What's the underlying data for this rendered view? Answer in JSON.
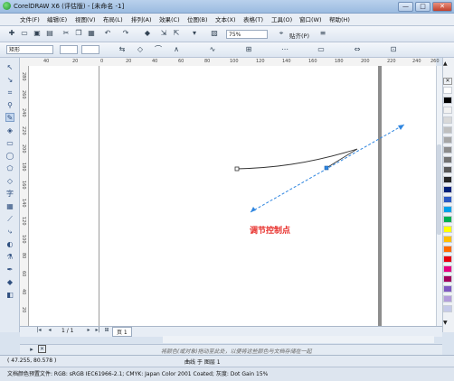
{
  "window": {
    "title": "CorelDRAW X6 (评估版) - [未命名 -1]",
    "controls": [
      "—",
      "□",
      "✕"
    ]
  },
  "menu": [
    "文件(F)",
    "编辑(E)",
    "视图(V)",
    "布局(L)",
    "排列(A)",
    "效果(C)",
    "位图(B)",
    "文本(X)",
    "表格(T)",
    "工具(O)",
    "窗口(W)",
    "帮助(H)"
  ],
  "toolbar": {
    "zoom_value": "75%",
    "snap_label": "贴齐(P)"
  },
  "property_bar": {
    "shape_type": "矩形",
    "field1": "",
    "field2": ""
  },
  "ruler": {
    "h_ticks": [
      "40",
      "20",
      "0",
      "20",
      "40",
      "60",
      "80",
      "100",
      "120",
      "140",
      "160",
      "180",
      "200",
      "220",
      "240",
      "260"
    ],
    "v_ticks": [
      "280",
      "260",
      "240",
      "220",
      "200",
      "180",
      "160",
      "140",
      "120",
      "100",
      "80",
      "60",
      "40",
      "20"
    ]
  },
  "annotation": "调节控制点",
  "page_nav": {
    "counter": "1 / 1",
    "tab": "页 1"
  },
  "hint": "将颜色(或对象)拖动至此处，以便将这些颜色与文档存储在一起",
  "status": {
    "coords": "( 47.255, 80.578 )",
    "object_info": "曲线 于 图层 1"
  },
  "doc_profile": "文档颜色预置文件: RGB: sRGB IEC61966-2.1; CMYK: Japan Color 2001 Coated; 灰度: Dot Gain 15%",
  "palette_colors": [
    "#ffffff",
    "#000000",
    "#f2f2f2",
    "#d9d9d9",
    "#bfbfbf",
    "#a6a6a6",
    "#8c8c8c",
    "#737373",
    "#595959",
    "#262626",
    "#00207a",
    "#2b59c3",
    "#00a0e9",
    "#00b050",
    "#ffff00",
    "#ffc000",
    "#ff6a00",
    "#e60012",
    "#e5007f",
    "#a3005c",
    "#7e57c2",
    "#b39ddb",
    "#c5cae9"
  ]
}
